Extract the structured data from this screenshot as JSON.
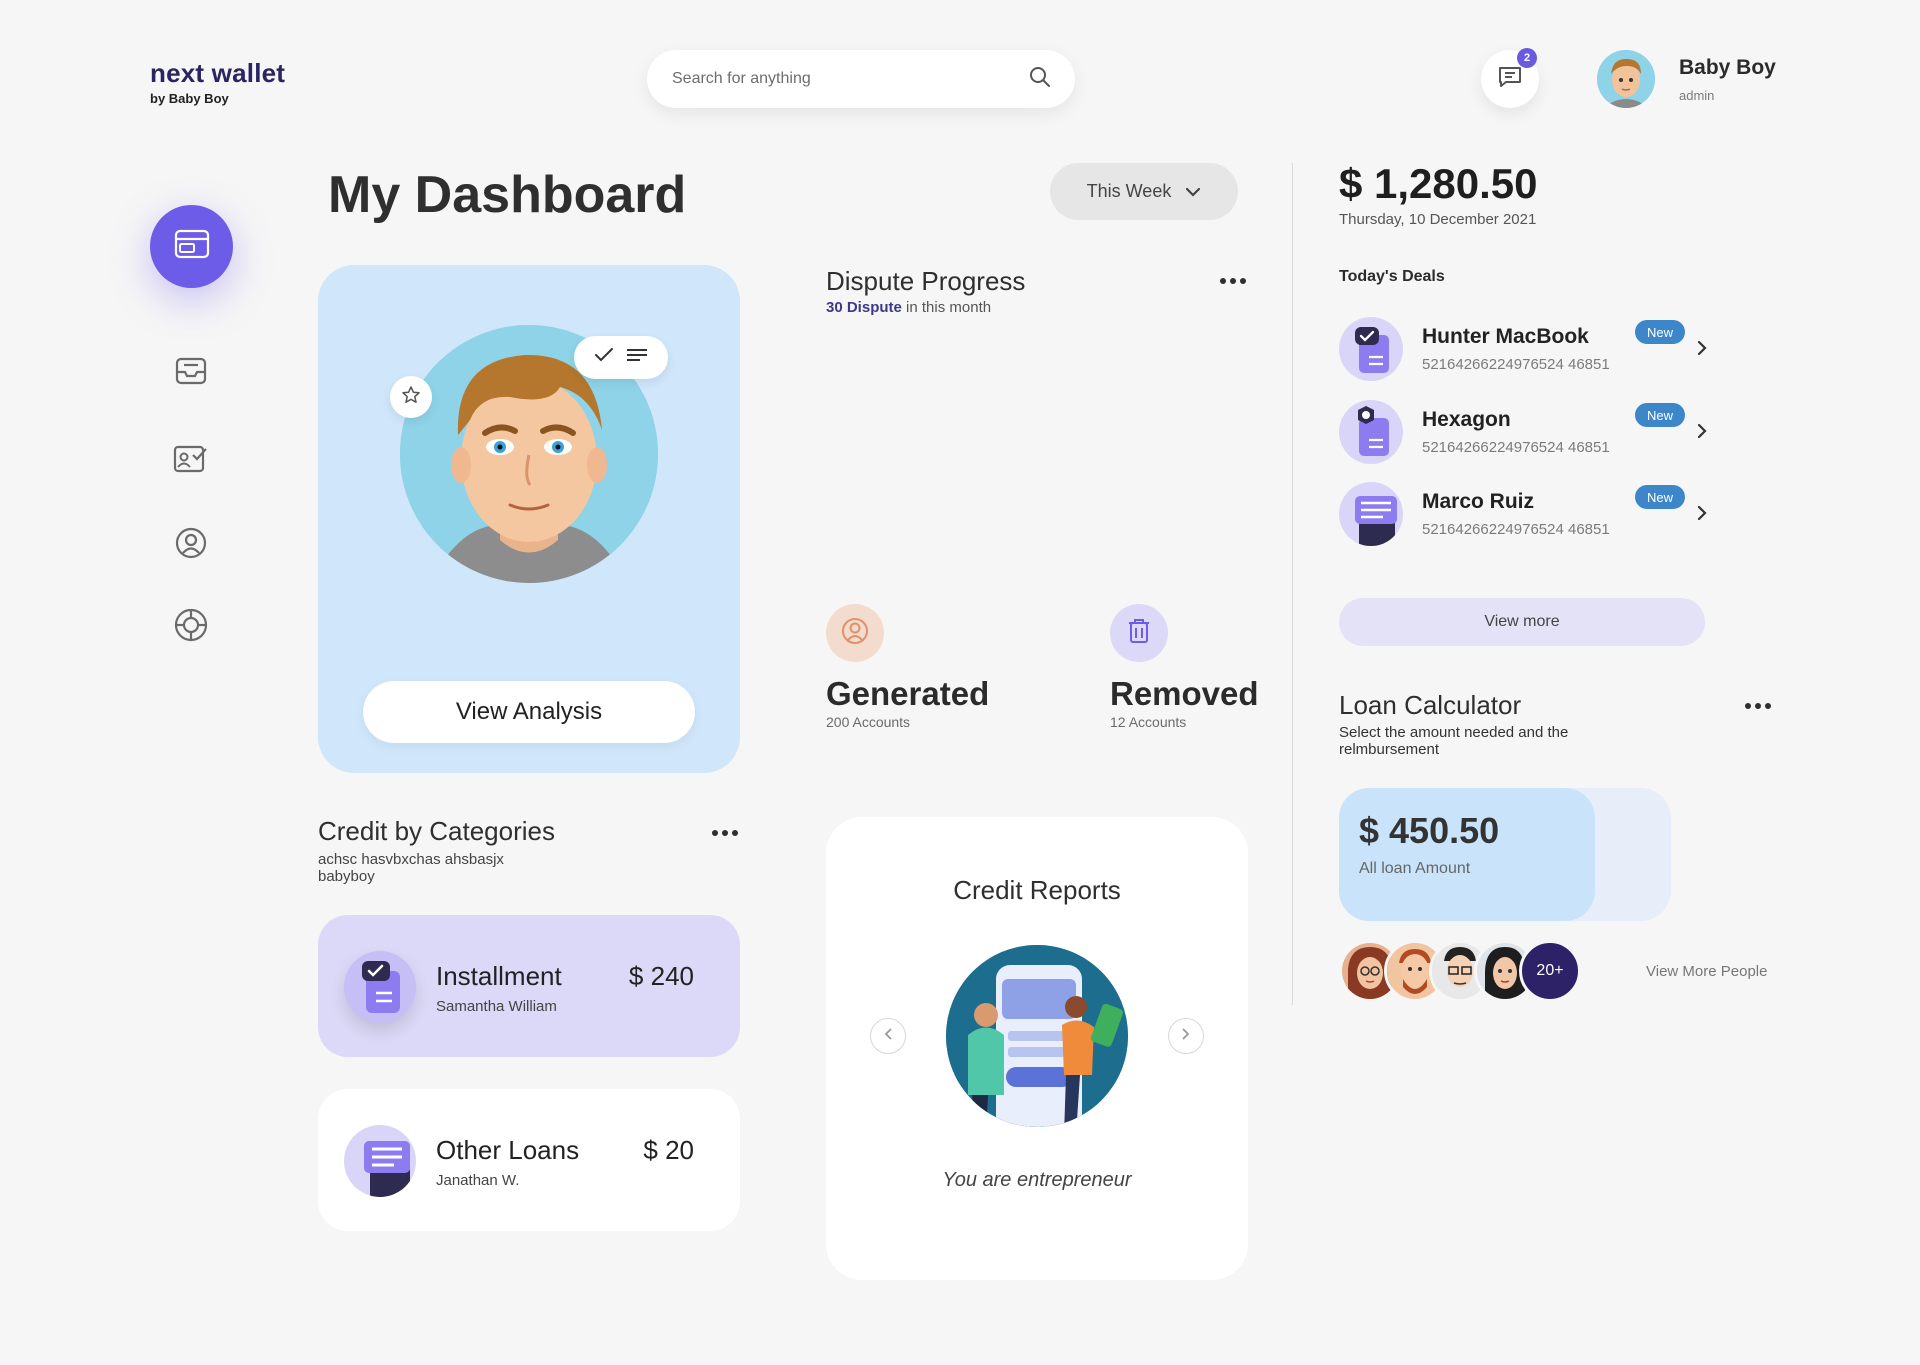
{
  "brand": {
    "name": "next wallet",
    "sub": "by Baby Boy"
  },
  "search": {
    "placeholder": "Search for anything"
  },
  "header": {
    "message_count": "2",
    "user_name": "Baby Boy",
    "user_role": "admin"
  },
  "sidebar": {
    "items": [
      {
        "icon": "wallet-icon",
        "active": true
      },
      {
        "icon": "inbox-icon",
        "active": false
      },
      {
        "icon": "id-check-icon",
        "active": false
      },
      {
        "icon": "user-circle-icon",
        "active": false
      },
      {
        "icon": "target-icon",
        "active": false
      }
    ]
  },
  "main": {
    "title": "My Dashboard",
    "period": "This Week",
    "profile": {
      "button_label": "View Analysis"
    },
    "dispute": {
      "title": "Dispute Progress",
      "count_text": "30 Dispute",
      "suffix": "in this month",
      "generated": {
        "label": "Generated",
        "sub": "200 Accounts"
      },
      "removed": {
        "label": "Removed",
        "sub": "12 Accounts"
      }
    },
    "categories": {
      "title": "Credit by Categories",
      "subtitle": "achsc hasvbxchas ahsbasjx babyboy",
      "items": [
        {
          "name": "Installment",
          "person": "Samantha William",
          "amount": "$ 240"
        },
        {
          "name": "Other Loans",
          "person": "Janathan W.",
          "amount": "$ 20"
        }
      ]
    },
    "reports": {
      "title": "Credit Reports",
      "caption": "You are entrepreneur"
    }
  },
  "right": {
    "balance": "$ 1,280.50",
    "date": "Thursday, 10 December 2021",
    "deals_title": "Today's Deals",
    "deals": [
      {
        "name": "Hunter MacBook",
        "number": "52164266224976524 46851",
        "badge": "New"
      },
      {
        "name": "Hexagon",
        "number": "52164266224976524 46851",
        "badge": "New"
      },
      {
        "name": "Marco Ruiz",
        "number": "52164266224976524 46851",
        "badge": "New"
      }
    ],
    "view_more": "View more",
    "loan": {
      "title": "Loan Calculator",
      "subtitle": "Select the amount needed and the relmbursement",
      "amount": "$ 450.50",
      "amount_label": "All loan Amount",
      "fill_fraction": 0.77
    },
    "people_more": "20+",
    "view_more_people": "View More People"
  },
  "colors": {
    "accent": "#6c5ce7",
    "navy": "#2d2268",
    "light_blue": "#cfe6fb",
    "lavender": "#dcd8f7",
    "badge_blue": "#3d86c9"
  }
}
